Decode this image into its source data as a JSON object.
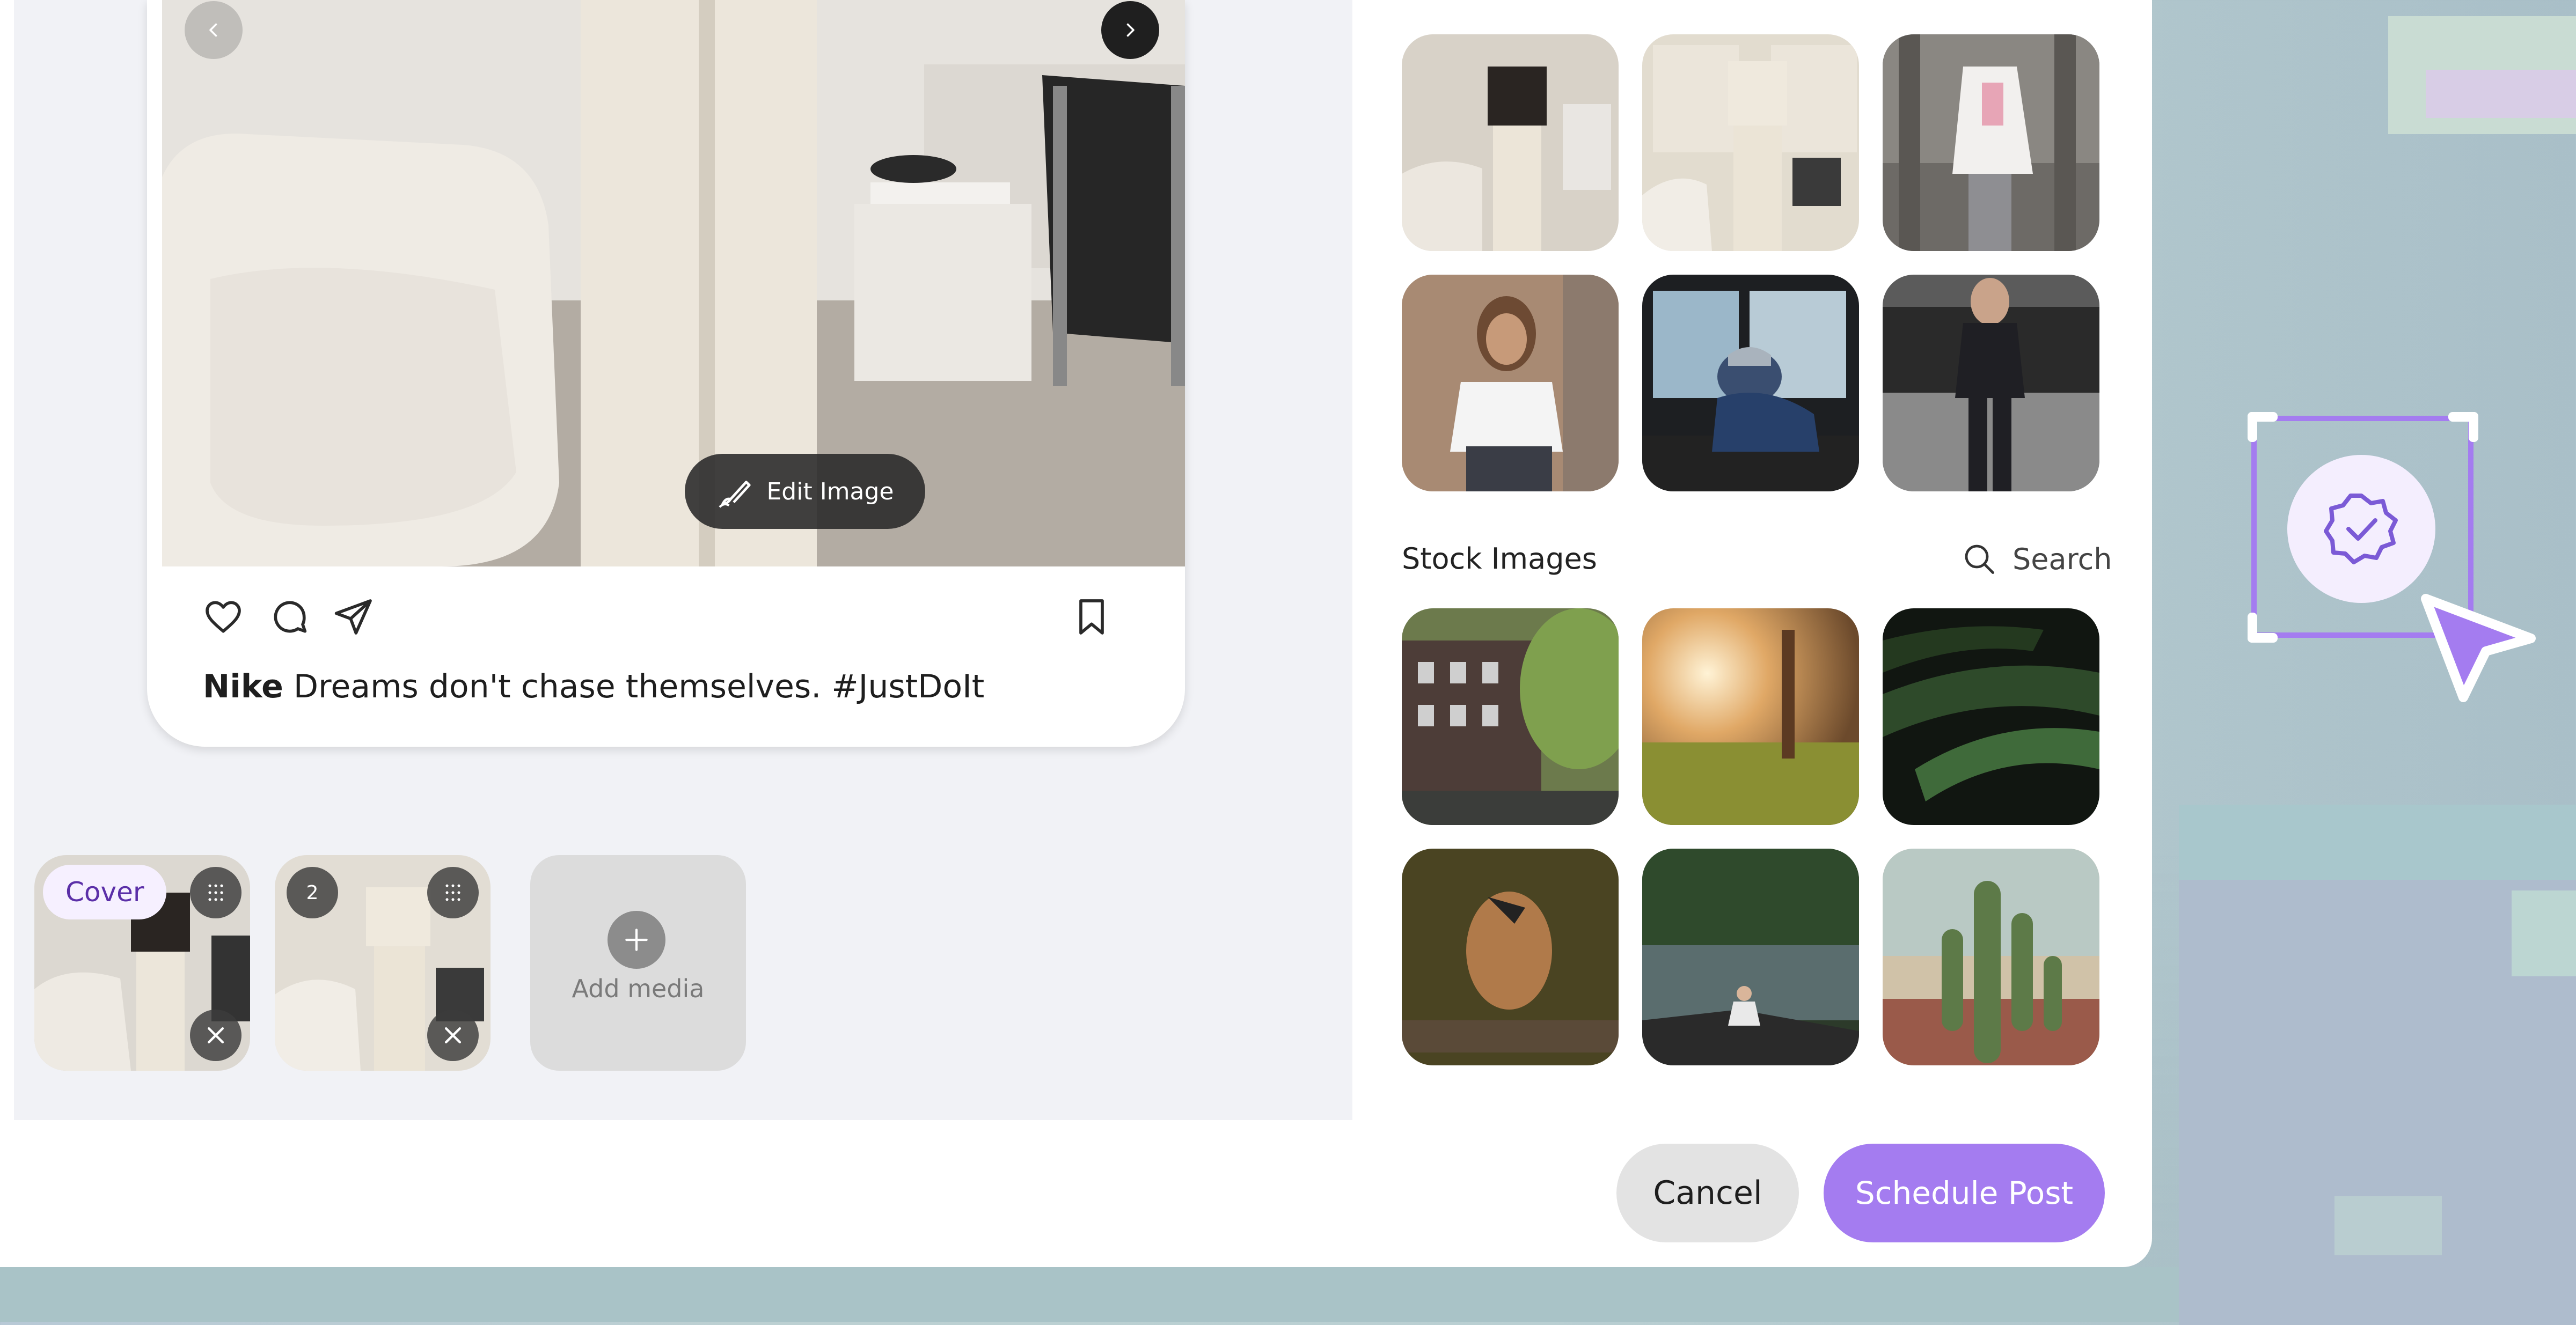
{
  "post_preview": {
    "edit_image_label": "Edit Image",
    "caption_user": "Nike",
    "caption_text": " Dreams don't chase themselves. #JustDoIt"
  },
  "media_strip": {
    "cover_label": "Cover",
    "second_index": "2",
    "add_media_label": "Add media"
  },
  "library": {
    "stock_images_title": "Stock Images",
    "search_label": "Search"
  },
  "footer": {
    "cancel_label": "Cancel",
    "schedule_label": "Schedule Post"
  },
  "colors": {
    "accent": "#a47cf0",
    "accent_dark": "#5b2fa8"
  }
}
